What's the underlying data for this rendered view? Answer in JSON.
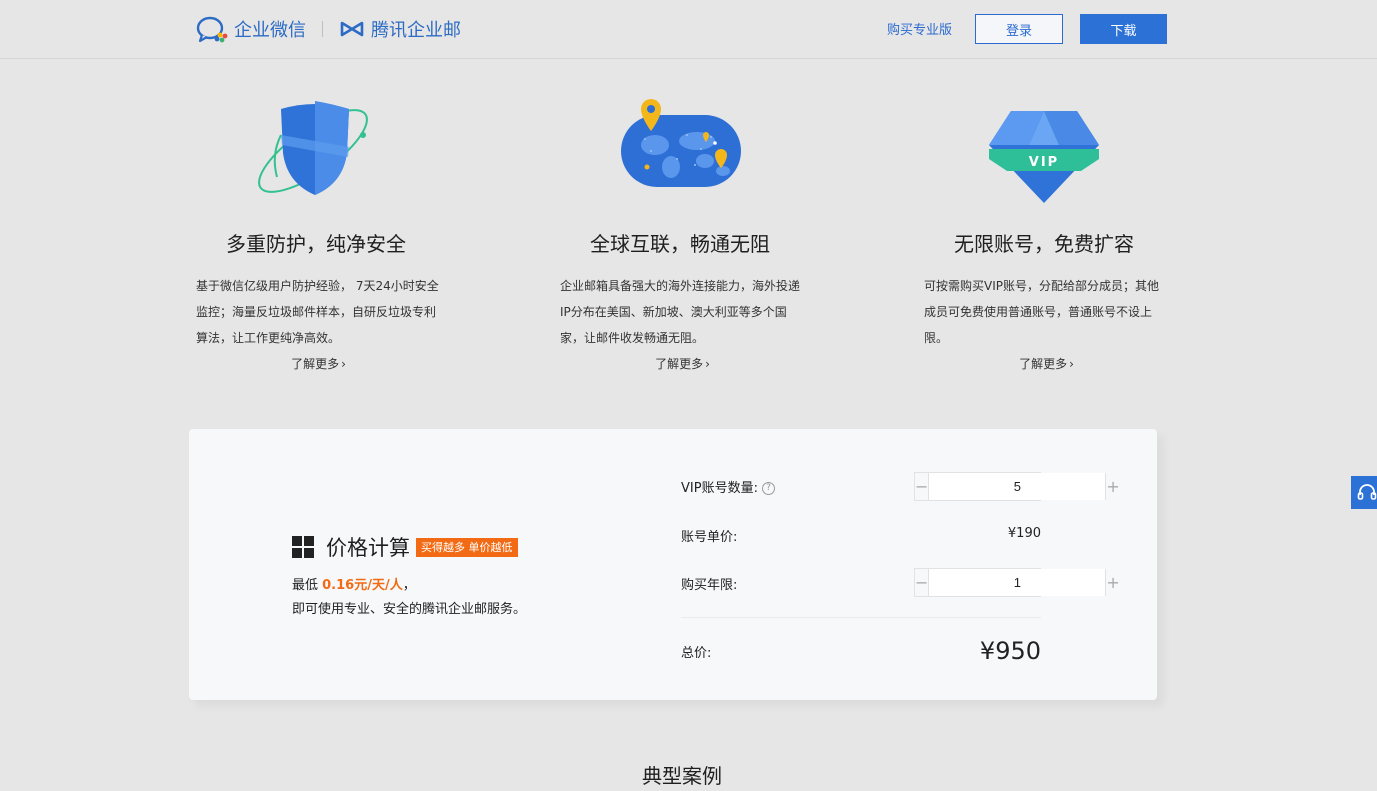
{
  "header": {
    "brand_wework": "企业微信",
    "brand_exmail": "腾讯企业邮",
    "buy_pro": "购买专业版",
    "login": "登录",
    "download": "下载"
  },
  "features": [
    {
      "title": "多重防护，纯净安全",
      "desc": "基于微信亿级用户防护经验， 7天24小时安全监控；海量反垃圾邮件样本，自研反垃圾专利算法，让工作更纯净高效。",
      "more": "了解更多",
      "icon": "shield-icon"
    },
    {
      "title": "全球互联，畅通无阻",
      "desc": "企业邮箱具备强大的海外连接能力，海外投递IP分布在美国、新加坡、澳大利亚等多个国家，让邮件收发畅通无阻。",
      "more": "了解更多",
      "icon": "globe-map-icon"
    },
    {
      "title": "无限账号，免费扩容",
      "desc": "可按需购买VIP账号，分配给部分成员；其他成员可免费使用普通账号，普通账号不设上限。",
      "more": "了解更多",
      "icon": "vip-diamond-icon"
    }
  ],
  "price": {
    "title": "价格计算",
    "tag": "买得越多 单价越低",
    "sub_prefix": "最低 ",
    "sub_highlight": "0.16元/天/人",
    "sub_suffix": "，",
    "sub2": "即可使用专业、安全的腾讯企业邮服务。",
    "vip_count_label": "VIP账号数量:",
    "vip_count_value": "5",
    "unit_price_label": "账号单价:",
    "unit_price_value": "¥190",
    "years_label": "购买年限:",
    "years_value": "1",
    "total_label": "总价:",
    "total_value": "¥950"
  },
  "cases": {
    "title": "典型案例"
  },
  "colors": {
    "accent": "#2b71d6",
    "highlight": "#f26b14",
    "background": "#e6e6e6"
  }
}
